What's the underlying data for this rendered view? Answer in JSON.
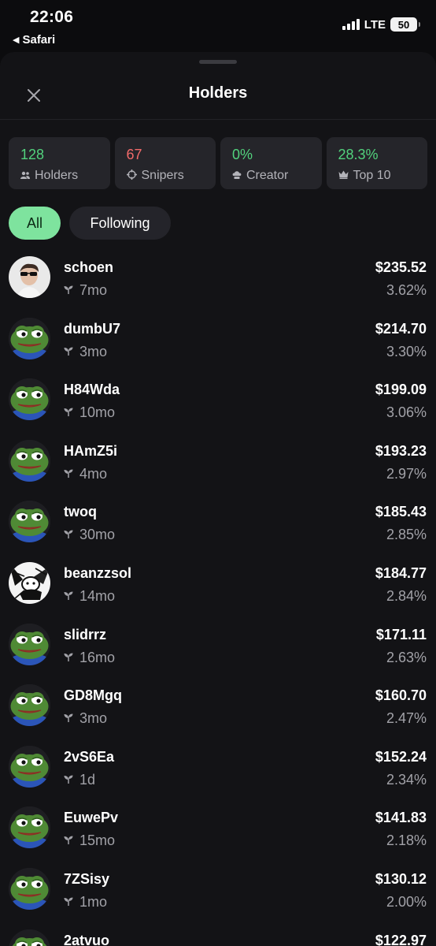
{
  "status_bar": {
    "time": "22:06",
    "back_app": "Safari",
    "network": "LTE",
    "battery": "50"
  },
  "sheet": {
    "title": "Holders",
    "close_icon": "close-icon"
  },
  "stats": [
    {
      "value": "128",
      "label": "Holders",
      "icon": "people-icon",
      "color": "#52d27d"
    },
    {
      "value": "67",
      "label": "Snipers",
      "icon": "crosshair-icon",
      "color": "#f26a6a"
    },
    {
      "value": "0%",
      "label": "Creator",
      "icon": "chef-hat-icon",
      "color": "#52d27d"
    },
    {
      "value": "28.3%",
      "label": "Top 10",
      "icon": "crown-icon",
      "color": "#52d27d"
    }
  ],
  "tabs": {
    "all": "All",
    "following": "Following"
  },
  "holders": [
    {
      "name": "schoen",
      "age": "7mo",
      "amount": "$235.52",
      "percent": "3.62%",
      "avatar": "person-photo"
    },
    {
      "name": "dumbU7",
      "age": "3mo",
      "amount": "$214.70",
      "percent": "3.30%",
      "avatar": "pepe"
    },
    {
      "name": "H84Wda",
      "age": "10mo",
      "amount": "$199.09",
      "percent": "3.06%",
      "avatar": "pepe"
    },
    {
      "name": "HAmZ5i",
      "age": "4mo",
      "amount": "$193.23",
      "percent": "2.97%",
      "avatar": "pepe"
    },
    {
      "name": "twoq",
      "age": "30mo",
      "amount": "$185.43",
      "percent": "2.85%",
      "avatar": "pepe"
    },
    {
      "name": "beanzzsol",
      "age": "14mo",
      "amount": "$184.77",
      "percent": "2.84%",
      "avatar": "manga"
    },
    {
      "name": "slidrrz",
      "age": "16mo",
      "amount": "$171.11",
      "percent": "2.63%",
      "avatar": "pepe"
    },
    {
      "name": "GD8Mgq",
      "age": "3mo",
      "amount": "$160.70",
      "percent": "2.47%",
      "avatar": "pepe"
    },
    {
      "name": "2vS6Ea",
      "age": "1d",
      "amount": "$152.24",
      "percent": "2.34%",
      "avatar": "pepe"
    },
    {
      "name": "EuwePv",
      "age": "15mo",
      "amount": "$141.83",
      "percent": "2.18%",
      "avatar": "pepe"
    },
    {
      "name": "7ZSisy",
      "age": "1mo",
      "amount": "$130.12",
      "percent": "2.00%",
      "avatar": "pepe"
    },
    {
      "name": "2atvuo",
      "age": "",
      "amount": "$122.97",
      "percent": "",
      "avatar": "pepe"
    }
  ]
}
